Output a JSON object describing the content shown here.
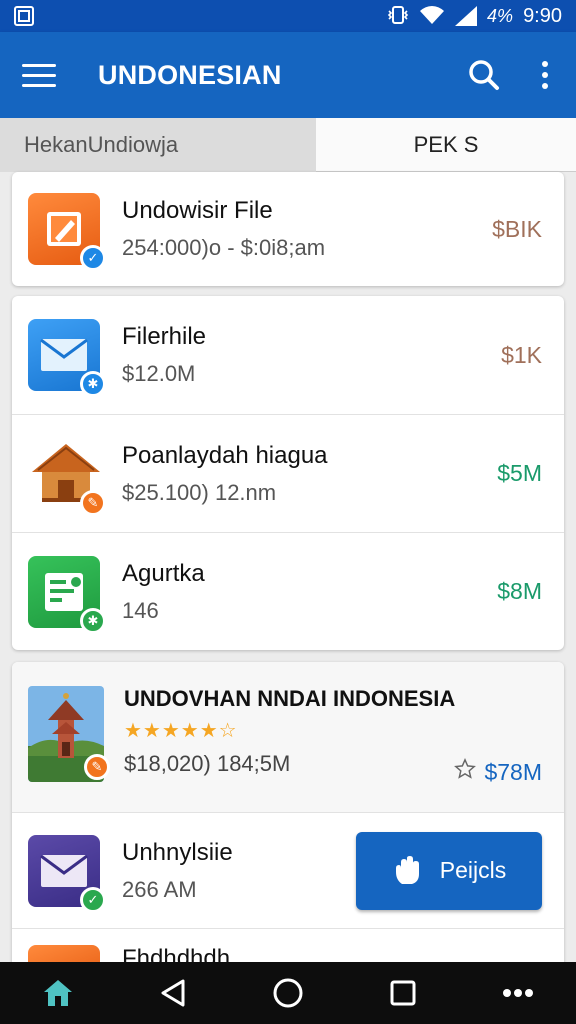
{
  "status_bar": {
    "battery": "4%",
    "time": "9:90"
  },
  "app_bar": {
    "title": "UNDONESIAN"
  },
  "tabs": [
    {
      "label": "HekanUndiowja"
    },
    {
      "label": "PEK S"
    }
  ],
  "list": [
    {
      "title": "Undowisir File",
      "subtitle": "254:000)o - $:0i8;am",
      "value": "$BIK",
      "value_color": "#a0705a"
    },
    {
      "title": "Filerhile",
      "subtitle": "$12.0M",
      "value": "$1K",
      "value_color": "#a0705a"
    },
    {
      "title": "Poanlaydah hiagua",
      "subtitle": "$25.100) 12.nm",
      "value": "$5M",
      "value_color": "#1a9a6a"
    },
    {
      "title": "Agurtka",
      "subtitle": "146",
      "value": "$8M",
      "value_color": "#1a9a6a"
    }
  ],
  "featured": {
    "title": "UNDOVHAN NNDAI INDONESIA",
    "rating_stars": "★★★★★☆",
    "subtitle": "$18,020) 184;5M",
    "value": "$78M"
  },
  "action_row": {
    "title": "Unhnylsiie",
    "subtitle": "266 AM",
    "button_label": "Peijcls"
  },
  "partial_row": {
    "title": "Fhdhdhdh"
  },
  "colors": {
    "primary": "#1565c0",
    "status_bar": "#0d4fb0",
    "accent_green": "#1a9a6a"
  }
}
